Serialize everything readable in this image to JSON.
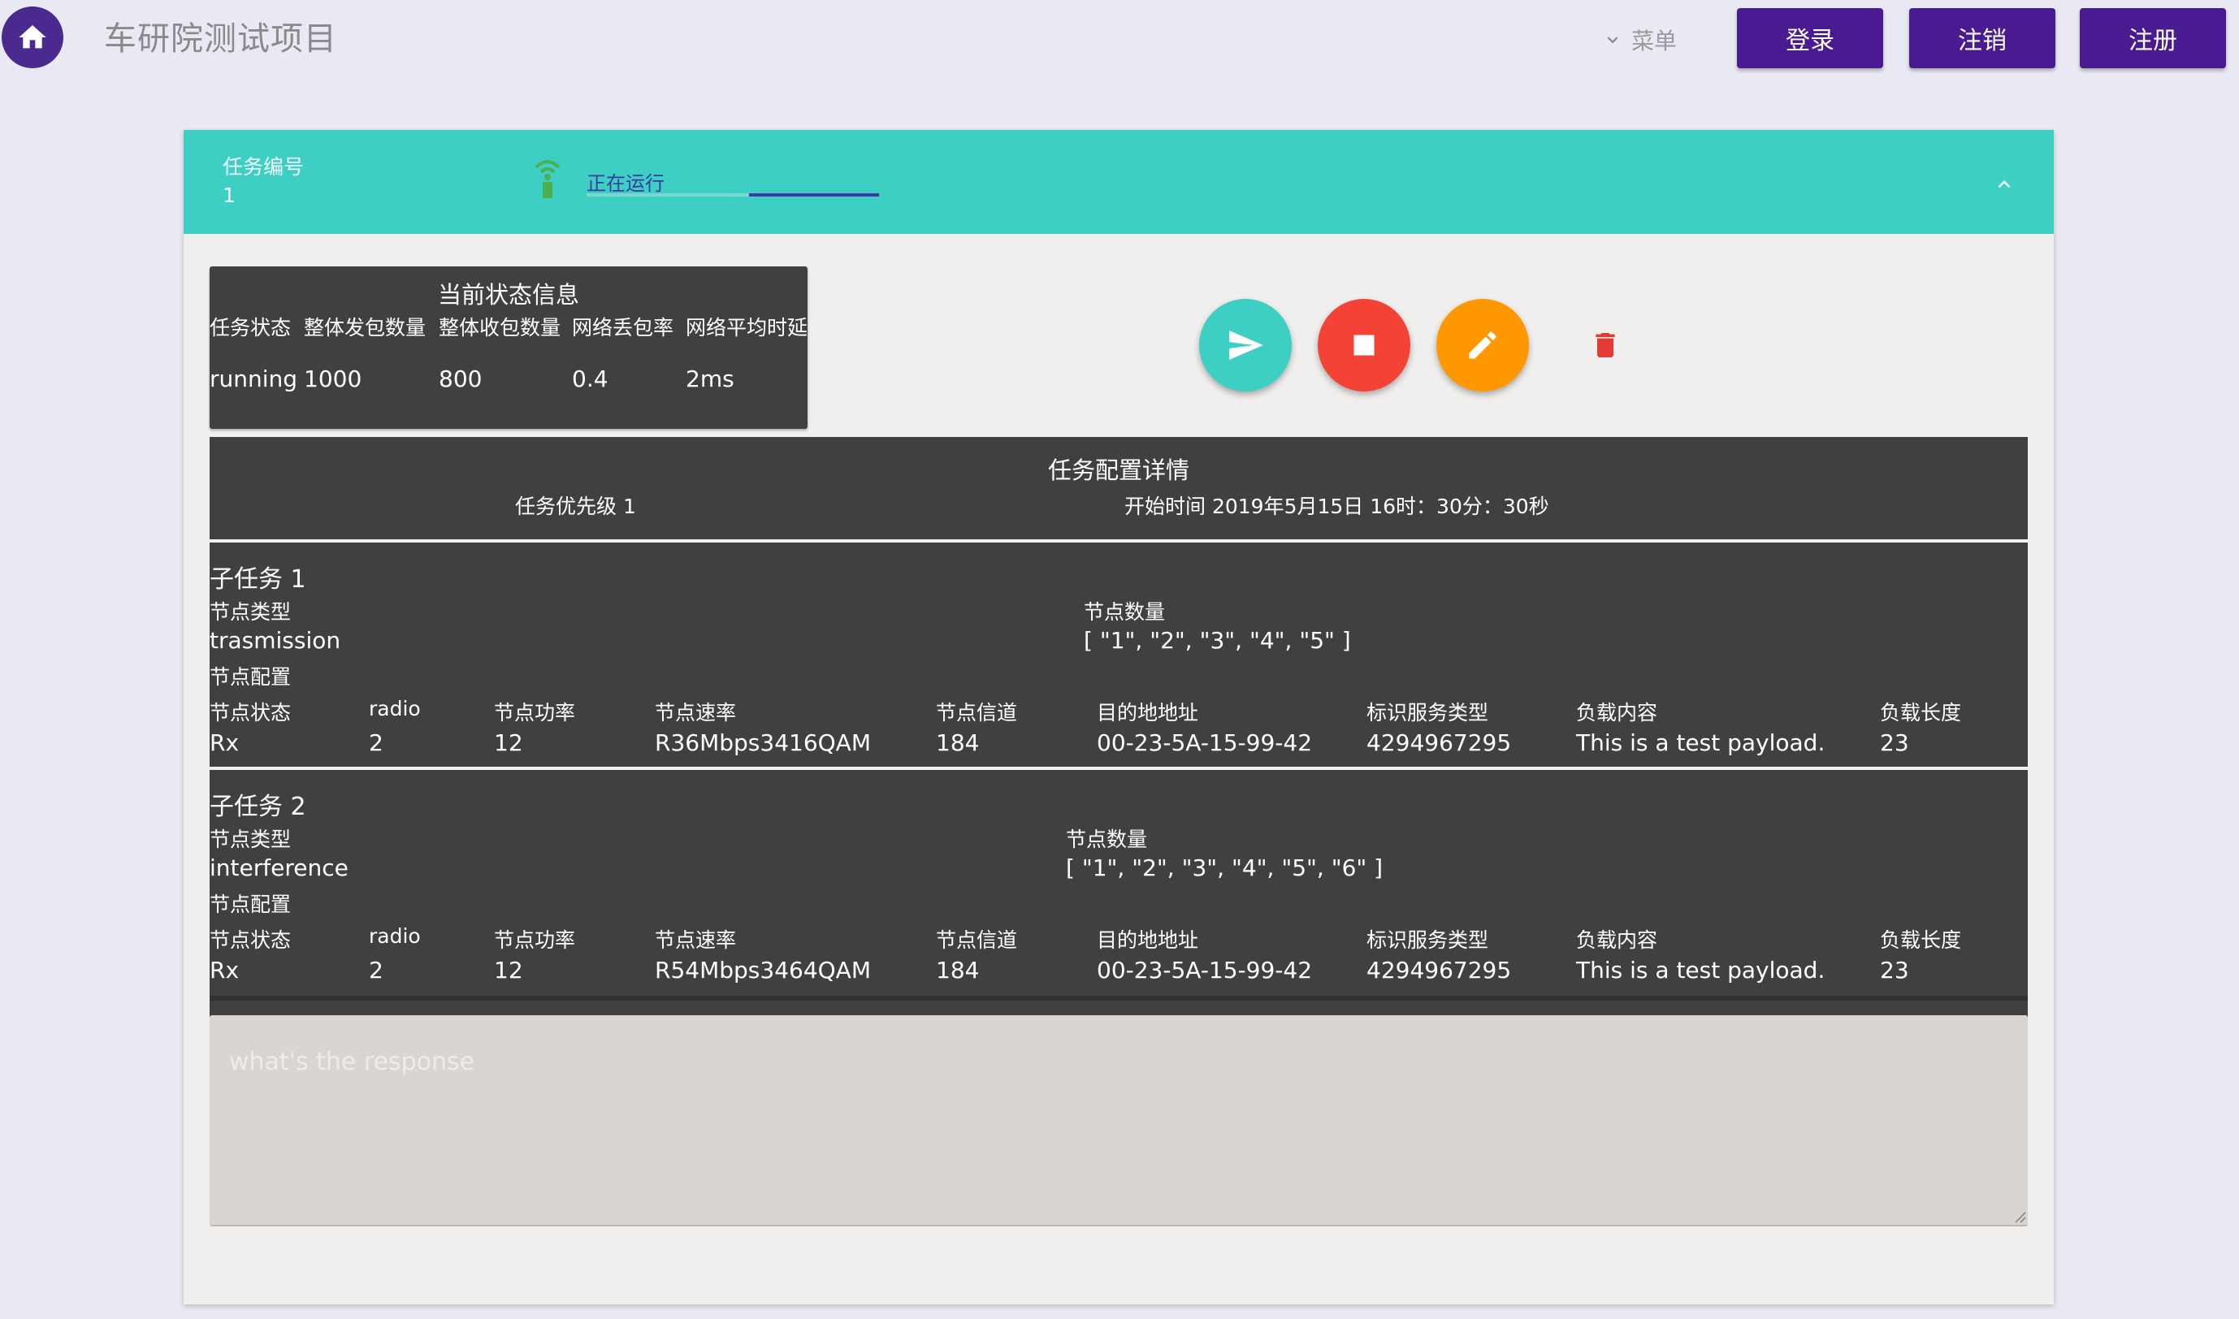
{
  "header": {
    "app_title": "车研院测试项目",
    "menu_label": "菜单",
    "buttons": {
      "login": "登录",
      "logout": "注销",
      "register": "注册"
    },
    "brand_color": "#4a1a91"
  },
  "task": {
    "id_label": "任务编号",
    "id_value": "1",
    "status_text": "正在运行",
    "header_color": "#3ecfc4"
  },
  "status_info": {
    "title": "当前状态信息",
    "headers": [
      "任务状态",
      "整体发包数量",
      "整体收包数量",
      "网络丢包率",
      "网络平均时延"
    ],
    "values": [
      "running",
      "1000",
      "800",
      "0.4",
      "2ms"
    ]
  },
  "actions": {
    "icons": [
      "send-icon",
      "stop-icon",
      "edit-icon",
      "delete-icon"
    ],
    "colors": {
      "send": "#3ecfc4",
      "stop": "#f44336",
      "edit": "#ff9800",
      "delete": "#e53935"
    }
  },
  "config": {
    "title": "任务配置详情",
    "priority_text": "任务优先级 1",
    "start_time_text": "开始时间 2019年5月15日 16时：30分：30秒",
    "field_labels": {
      "node_type": "节点类型",
      "node_count": "节点数量",
      "node_config": "节点配置"
    },
    "columns": [
      "节点状态",
      "radio",
      "节点功率",
      "节点速率",
      "节点信道",
      "目的地地址",
      "标识服务类型",
      "负载内容",
      "负载长度"
    ],
    "subtasks": [
      {
        "title": "子任务 1",
        "node_type": "trasmission",
        "node_count": "[ \"1\", \"2\", \"3\", \"4\", \"5\" ]",
        "row": [
          "Rx",
          "2",
          "12",
          "R36Mbps3416QAM",
          "184",
          "00-23-5A-15-99-42",
          "4294967295",
          "This is a test payload.",
          "23"
        ]
      },
      {
        "title": "子任务 2",
        "node_type": "interference",
        "node_count": "[ \"1\", \"2\", \"3\", \"4\", \"5\", \"6\" ]",
        "row": [
          "Rx",
          "2",
          "12",
          "R54Mbps3464QAM",
          "184",
          "00-23-5A-15-99-42",
          "4294967295",
          "This is a test payload.",
          "23"
        ]
      }
    ]
  },
  "response": {
    "placeholder": "what's the response"
  }
}
